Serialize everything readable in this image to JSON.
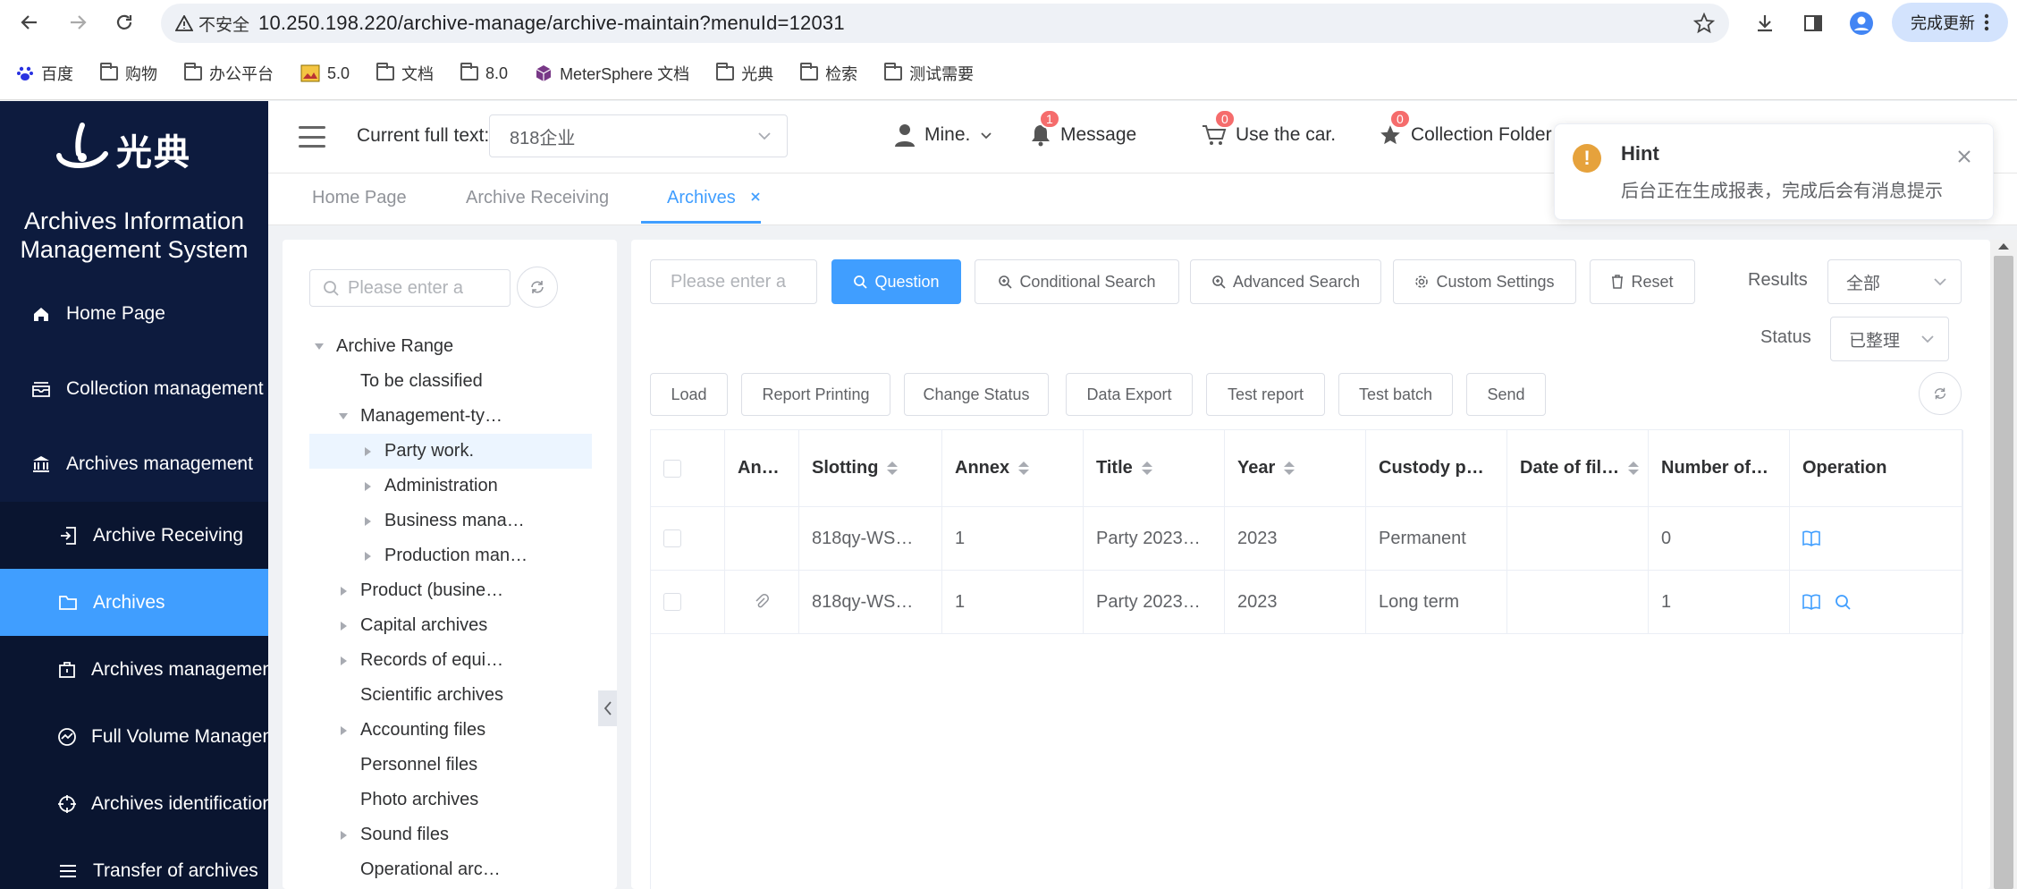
{
  "browser": {
    "security_label": "不安全",
    "url": "10.250.198.220/archive-manage/archive-maintain?menuId=12031",
    "update_label": "完成更新",
    "bookmarks": [
      "百度",
      "购物",
      "办公平台",
      "5.0",
      "文档",
      "8.0",
      "MeterSphere 文档",
      "光典",
      "检索",
      "测试需要"
    ]
  },
  "sidebar": {
    "logo_text": "光典",
    "system_title_line1": "Archives Information",
    "system_title_line2": "Management System",
    "items": [
      {
        "label": "Home Page",
        "icon": "home-icon"
      },
      {
        "label": "Collection management",
        "icon": "inbox-icon"
      },
      {
        "label": "Archives management",
        "icon": "bank-icon"
      },
      {
        "label": "Archive Receiving",
        "icon": "import-icon"
      },
      {
        "label": "Archives",
        "icon": "folder-icon"
      },
      {
        "label": "Archives management",
        "icon": "briefcase-icon"
      },
      {
        "label": "Full Volume Management",
        "icon": "chart-circle-icon"
      },
      {
        "label": "Archives identification",
        "icon": "target-icon"
      },
      {
        "label": "Transfer of archives",
        "icon": "list-icon"
      }
    ]
  },
  "header": {
    "full_text_label": "Current full text:",
    "full_text_value": "818企业",
    "user_label": "Mine.",
    "message_label": "Message",
    "message_count": "1",
    "car_label": "Use the car.",
    "car_count": "0",
    "collection_label": "Collection Folder",
    "collection_count": "0"
  },
  "tabs": [
    {
      "label": "Home Page"
    },
    {
      "label": "Archive Receiving"
    },
    {
      "label": "Archives"
    }
  ],
  "tree": {
    "search_placeholder": "Please enter a",
    "nodes": [
      {
        "label": "Archive Range",
        "level": 0,
        "arrow": "down"
      },
      {
        "label": "To be classified",
        "level": 1,
        "arrow": ""
      },
      {
        "label": "Management-ty…",
        "level": 1,
        "arrow": "down"
      },
      {
        "label": "Party work.",
        "level": 2,
        "arrow": "right",
        "selected": true
      },
      {
        "label": "Administration",
        "level": 2,
        "arrow": "right"
      },
      {
        "label": "Business mana…",
        "level": 2,
        "arrow": "right"
      },
      {
        "label": "Production man…",
        "level": 2,
        "arrow": "right"
      },
      {
        "label": "Product (busine…",
        "level": 1,
        "arrow": "right"
      },
      {
        "label": "Capital archives",
        "level": 1,
        "arrow": "right"
      },
      {
        "label": "Records of equi…",
        "level": 1,
        "arrow": "right"
      },
      {
        "label": "Scientific archives",
        "level": 1,
        "arrow": ""
      },
      {
        "label": "Accounting files",
        "level": 1,
        "arrow": "right"
      },
      {
        "label": "Personnel files",
        "level": 1,
        "arrow": ""
      },
      {
        "label": "Photo archives",
        "level": 1,
        "arrow": ""
      },
      {
        "label": "Sound files",
        "level": 1,
        "arrow": "right"
      },
      {
        "label": "Operational arc…",
        "level": 1,
        "arrow": ""
      }
    ]
  },
  "toolbar": {
    "search_placeholder": "Please enter a",
    "question": "Question",
    "conditional_search": "Conditional Search",
    "advanced_search": "Advanced Search",
    "custom_settings": "Custom Settings",
    "reset": "Reset",
    "results_label": "Results",
    "results_value": "全部",
    "status_label": "Status",
    "status_value": "已整理",
    "load": "Load",
    "report_printing": "Report Printing",
    "change_status": "Change Status",
    "data_export": "Data Export",
    "test_report": "Test report",
    "test_batch": "Test batch",
    "send": "Send"
  },
  "table": {
    "columns": [
      "An…",
      "Slotting",
      "Annex",
      "Title",
      "Year",
      "Custody p…",
      "Date of fil…",
      "Number of…",
      "Operation"
    ],
    "rows": [
      {
        "attachment": false,
        "slotting": "818qy-WS…",
        "annex": "1",
        "title": "Party 2023…",
        "year": "2023",
        "custody": "Permanent",
        "date": "",
        "number": "0",
        "ops": [
          "book-icon"
        ]
      },
      {
        "attachment": true,
        "slotting": "818qy-WS…",
        "annex": "1",
        "title": "Party 2023…",
        "year": "2023",
        "custody": "Long term",
        "date": "",
        "number": "1",
        "ops": [
          "book-icon",
          "search-icon"
        ]
      }
    ]
  },
  "notification": {
    "title": "Hint",
    "message": "后台正在生成报表，完成后会有消息提示"
  },
  "colors": {
    "primary": "#409eff",
    "sidebar_bg": "#0d1b3e",
    "badge": "#f56c6c",
    "warning": "#e6a23c"
  }
}
